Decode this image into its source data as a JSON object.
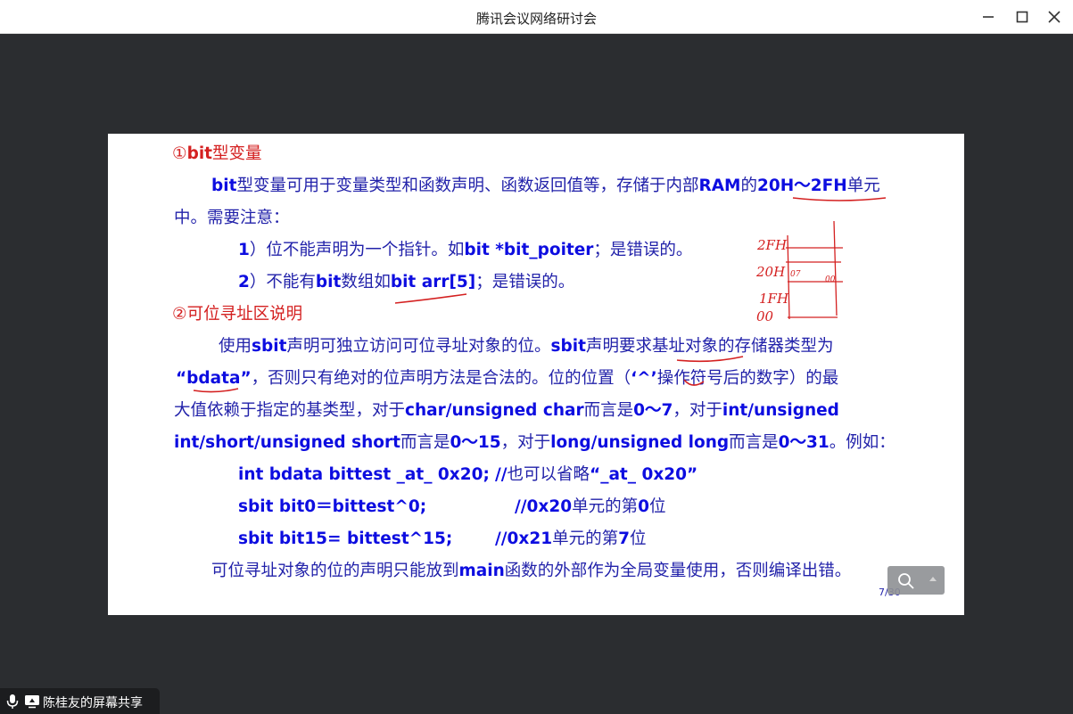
{
  "window": {
    "title": "腾讯会议网络研讨会",
    "controls": [
      "minimize-icon",
      "maximize-icon",
      "close-icon"
    ]
  },
  "slide": {
    "page_indicator": "7/30",
    "heading1": {
      "num": "①",
      "bold": "bit",
      "rest": "型变量"
    },
    "para1": {
      "s1": "bit",
      "s2": "型变量可用于变量类型和函数声明、函数返回值等，存储于内部",
      "s3": "RAM",
      "s4": "的",
      "s5": "20H",
      "s6": "～",
      "s7": "2FH",
      "s8": "单元",
      "line2": "中。需要注意："
    },
    "note1": {
      "a": "1",
      "b": "）位不能声明为一个指针。如",
      "c": "bit *bit_poiter",
      "d": "；是错误的。"
    },
    "note2": {
      "a": "2",
      "b": "）不能有",
      "c": "bit",
      "d": "数组如",
      "e": "bit arr[5]",
      "f": "；是错误的。"
    },
    "heading2": {
      "num": "②",
      "rest": "可位寻址区说明"
    },
    "para2": {
      "l1a": "使用",
      "l1b": "sbit",
      "l1c": "声明可独立访问可位寻址对象的位。",
      "l1d": "sbit",
      "l1e": "声明要求基址对象的存储器类型为",
      "l2a": "“",
      "l2b": "bdata",
      "l2c": "”",
      "l2d": "，否则只有绝对的位声明方法是合法的。位的位置（",
      "l2e": "‘^’",
      "l2f": "操作符号后的数字）的最",
      "l3a": "大值依赖于指定的基类型，对于",
      "l3b": "char/unsigned char",
      "l3c": "而言是",
      "l3d": "0",
      "l3e": "～",
      "l3f": "7",
      "l3g": "，对于",
      "l3h": "int/unsigned",
      "l4a": "int/short/unsigned short",
      "l4b": "而言是",
      "l4c": "0",
      "l4d": "～",
      "l4e": "15",
      "l4f": "，对于",
      "l4g": "long/unsigned long",
      "l4h": "而言是",
      "l4i": "0",
      "l4j": "～",
      "l4k": "31",
      "l4l": "。例如："
    },
    "code": {
      "c1": "int bdata bittest _at_ 0x20;",
      "c1cmt_a": "//",
      "c1cmt_b": "也可以省略",
      "c1cmt_c": "“",
      "c1cmt_d": "_at_ 0x20",
      "c1cmt_e": "”",
      "c2": "sbit bit0＝bittest^0;",
      "c2cmt_a": "//0x20",
      "c2cmt_b": "单元的第",
      "c2cmt_c": "0",
      "c2cmt_d": "位",
      "c3": "sbit bit15= bittest^15;",
      "c3cmt_a": "//0x21",
      "c3cmt_b": "单元的第",
      "c3cmt_c": "7",
      "c3cmt_d": "位"
    },
    "closing": {
      "a": "可位寻址对象的位的声明只能放到",
      "b": "main",
      "c": "函数的外部作为全局变量使用，否则编译出错。"
    },
    "handwriting": {
      "t1": "2FH",
      "t2": "20H",
      "t3": "07",
      "t4": "00",
      "t5": "1FH",
      "t6": "00"
    }
  },
  "share_tag": {
    "label": "陈桂友的屏幕共享"
  }
}
